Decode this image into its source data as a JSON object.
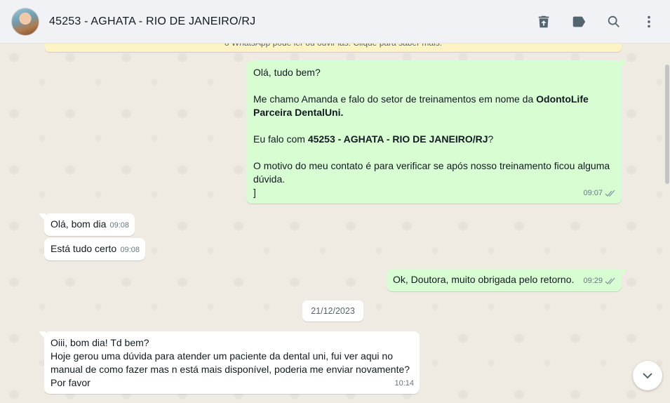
{
  "header": {
    "title": "45253 - AGHATA - RIO DE JANEIRO/RJ"
  },
  "notice": {
    "text": "o WhatsApp pode ler ou ouvir las. Clique para saber mais."
  },
  "messages": [
    {
      "direction": "outgoing",
      "line1": "Olá, tudo bem?",
      "line2_prefix": "Me chamo Amanda e falo do setor de treinamentos em nome da ",
      "line2_bold": "OdontoLife Parceira DentalUni.",
      "line3_prefix": " Eu falo com ",
      "line3_bold": "45253 - AGHATA - RIO DE JANEIRO/RJ",
      "line3_suffix": "?",
      "line4": "O motivo do meu contato é para verificar se após nosso treinamento ficou alguma dúvida.",
      "line5": "]",
      "time": "09:07"
    },
    {
      "direction": "incoming",
      "text": "Olá, bom dia",
      "time": "09:08"
    },
    {
      "direction": "incoming",
      "text": "Está tudo certo",
      "time": "09:08"
    },
    {
      "direction": "outgoing",
      "text": "Ok, Doutora, muito obrigada pelo retorno.",
      "time": "09:29"
    },
    {
      "direction": "incoming",
      "line1": "Oiii, bom dia! Td bem?",
      "line2": "Hoje gerou uma dúvida para atender um paciente da dental uni, fui ver aqui no manual de como fazer mas n está mais disponível, poderia me enviar novamente?",
      "line3": "Por favor",
      "time": "10:14"
    }
  ],
  "date_separator": "21/12/2023",
  "colors": {
    "outgoing_bubble": "#d9fdd3",
    "incoming_bubble": "#ffffff",
    "chat_background": "#efeae2",
    "header_background": "#f0f2f5"
  },
  "icons": {
    "delete": "delete-icon",
    "label": "label-icon",
    "search": "search-icon",
    "menu": "menu-icon",
    "scroll_down": "chevron-down-icon"
  }
}
